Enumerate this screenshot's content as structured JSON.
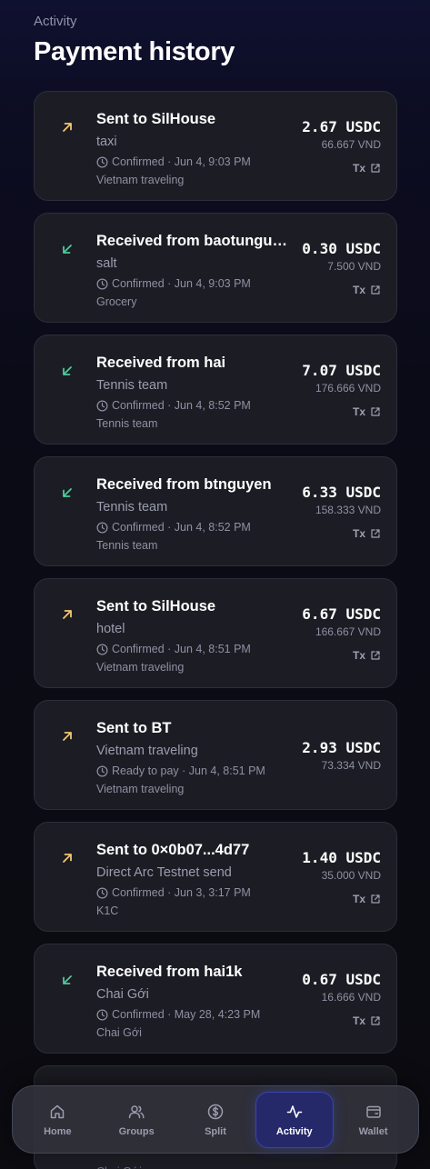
{
  "header": {
    "eyebrow": "Activity",
    "title": "Payment history"
  },
  "colors": {
    "sent": "#f2c76e",
    "received": "#4ec99a",
    "accent": "#3d44a8"
  },
  "tx_label": "Tx",
  "payments": [
    {
      "direction": "sent",
      "party": "Sent to SilHouse",
      "memo": "taxi",
      "status": "Confirmed · Jun 4, 9:03 PM",
      "group": "Vietnam traveling",
      "amount": "2.67 USDC",
      "fiat": "66.667 VND",
      "has_tx": true
    },
    {
      "direction": "received",
      "party": "Received from baotunguyen",
      "memo": "salt",
      "status": "Confirmed · Jun 4, 9:03 PM",
      "group": "Grocery",
      "amount": "0.30 USDC",
      "fiat": "7.500 VND",
      "has_tx": true
    },
    {
      "direction": "received",
      "party": "Received from hai",
      "memo": "Tennis team",
      "status": "Confirmed · Jun 4, 8:52 PM",
      "group": "Tennis team",
      "amount": "7.07 USDC",
      "fiat": "176.666 VND",
      "has_tx": true
    },
    {
      "direction": "received",
      "party": "Received from btnguyen",
      "memo": "Tennis team",
      "status": "Confirmed · Jun 4, 8:52 PM",
      "group": "Tennis team",
      "amount": "6.33 USDC",
      "fiat": "158.333 VND",
      "has_tx": true
    },
    {
      "direction": "sent",
      "party": "Sent to SilHouse",
      "memo": "hotel",
      "status": "Confirmed · Jun 4, 8:51 PM",
      "group": "Vietnam traveling",
      "amount": "6.67 USDC",
      "fiat": "166.667 VND",
      "has_tx": true
    },
    {
      "direction": "sent",
      "party": "Sent to BT",
      "memo": "Vietnam traveling",
      "status": "Ready to pay · Jun 4, 8:51 PM",
      "group": "Vietnam traveling",
      "amount": "2.93 USDC",
      "fiat": "73.334 VND",
      "has_tx": false
    },
    {
      "direction": "sent",
      "party": "Sent to 0×0b07...4d77",
      "memo": "Direct Arc Testnet send",
      "status": "Confirmed · Jun 3, 3:17 PM",
      "group": "K1C",
      "amount": "1.40 USDC",
      "fiat": "35.000 VND",
      "has_tx": true
    },
    {
      "direction": "received",
      "party": "Received from hai1k",
      "memo": "Chai Gới",
      "status": "Confirmed · May 28, 4:23 PM",
      "group": "Chai Gới",
      "amount": "0.67 USDC",
      "fiat": "16.666 VND",
      "has_tx": true
    }
  ],
  "partial_card_text": "Chai Gới",
  "nav": [
    {
      "label": "Home",
      "icon": "home-icon",
      "active": false
    },
    {
      "label": "Groups",
      "icon": "groups-icon",
      "active": false
    },
    {
      "label": "Split",
      "icon": "dollar-circle-icon",
      "active": false
    },
    {
      "label": "Activity",
      "icon": "activity-icon",
      "active": true
    },
    {
      "label": "Wallet",
      "icon": "wallet-icon",
      "active": false
    }
  ]
}
